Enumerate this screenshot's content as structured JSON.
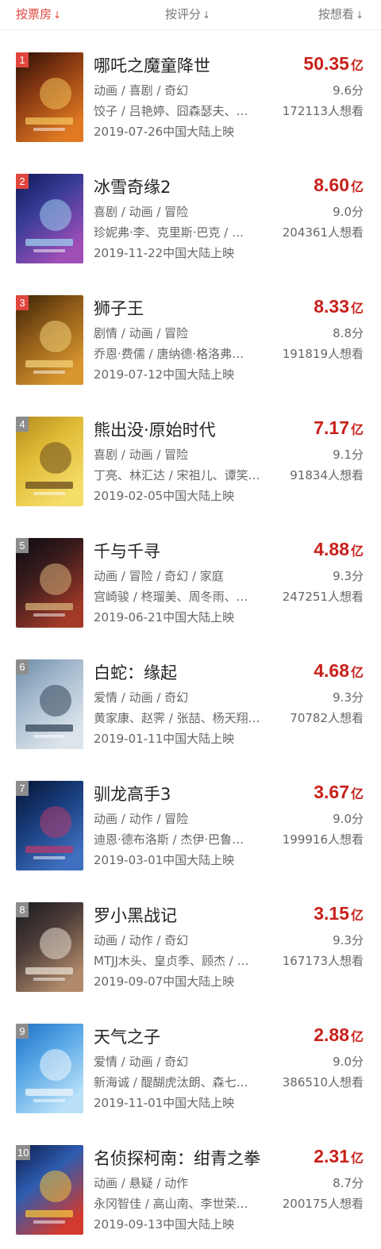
{
  "sort_tabs": [
    {
      "label": "按票房",
      "arrow": "↓"
    },
    {
      "label": "按评分",
      "arrow": "↓"
    },
    {
      "label": "按想看",
      "arrow": "↓"
    }
  ],
  "movies": [
    {
      "rank": "1",
      "title": "哪吒之魔童降世",
      "box": "50.35",
      "unit": "亿",
      "genres": "动画 / 喜剧 / 奇幻",
      "score": "9.6分",
      "cast": "饺子 / 吕艳婷、囧森瑟夫、…",
      "want": "172113人想看",
      "release": "2019-07-26中国大陆上映",
      "rank_color": "#e0463d",
      "poster_colors": [
        "#2a0f06",
        "#8a3a12",
        "#e07a22",
        "#f2c15a"
      ]
    },
    {
      "rank": "2",
      "title": "冰雪奇缘2",
      "box": "8.60",
      "unit": "亿",
      "genres": "喜剧 / 动画 / 冒险",
      "score": "9.0分",
      "cast": "珍妮弗·李、克里斯·巴克 / …",
      "want": "204361人想看",
      "release": "2019-11-22中国大陆上映",
      "rank_color": "#e0463d",
      "poster_colors": [
        "#0e1a55",
        "#3a3c98",
        "#a04fb7",
        "#9fd0f0"
      ]
    },
    {
      "rank": "3",
      "title": "狮子王",
      "box": "8.33",
      "unit": "亿",
      "genres": "剧情 / 动画 / 冒险",
      "score": "8.8分",
      "cast": "乔恩·费儒 / 唐纳德·格洛弗…",
      "want": "191819人想看",
      "release": "2019-07-12中国大陆上映",
      "rank_color": "#e0463d",
      "poster_colors": [
        "#3a2206",
        "#8d5a18",
        "#d8962e",
        "#f3d27a"
      ]
    },
    {
      "rank": "4",
      "title": "熊出没·原始时代",
      "box": "7.17",
      "unit": "亿",
      "genres": "喜剧 / 动画 / 冒险",
      "score": "9.1分",
      "cast": "丁亮、林汇达 / 宋祖儿、谭笑…",
      "want": "91834人想看",
      "release": "2019-02-05中国大陆上映",
      "rank_color": "#8c8c8c",
      "poster_colors": [
        "#b38a1e",
        "#e0bb36",
        "#f5dd6a",
        "#6a4a1c"
      ]
    },
    {
      "rank": "5",
      "title": "千与千寻",
      "box": "4.88",
      "unit": "亿",
      "genres": "动画 / 冒险 / 奇幻 / 家庭",
      "score": "9.3分",
      "cast": "宫崎骏 / 柊瑠美、周冬雨、…",
      "want": "247251人想看",
      "release": "2019-06-21中国大陆上映",
      "rank_color": "#8c8c8c",
      "poster_colors": [
        "#0d0b12",
        "#3a1c1c",
        "#a33a28",
        "#d7b07a"
      ]
    },
    {
      "rank": "6",
      "title": "白蛇：缘起",
      "box": "4.68",
      "unit": "亿",
      "genres": "爱情 / 动画 / 奇幻",
      "score": "9.3分",
      "cast": "黄家康、赵霁 / 张喆、杨天翔…",
      "want": "70782人想看",
      "release": "2019-01-11中国大陆上映",
      "rank_color": "#8c8c8c",
      "poster_colors": [
        "#6d8aa8",
        "#a7bccf",
        "#dde5ec",
        "#34465a"
      ]
    },
    {
      "rank": "7",
      "title": "驯龙高手3",
      "box": "3.67",
      "unit": "亿",
      "genres": "动画 / 动作 / 冒险",
      "score": "9.0分",
      "cast": "迪恩·德布洛斯 / 杰伊·巴鲁…",
      "want": "199916人想看",
      "release": "2019-03-01中国大陆上映",
      "rank_color": "#8c8c8c",
      "poster_colors": [
        "#071533",
        "#173a78",
        "#3f6fbf",
        "#b73a6d"
      ]
    },
    {
      "rank": "8",
      "title": "罗小黑战记",
      "box": "3.15",
      "unit": "亿",
      "genres": "动画 / 动作 / 奇幻",
      "score": "9.3分",
      "cast": "MTJJ木头、皇贞季、顾杰 / …",
      "want": "167173人想看",
      "release": "2019-09-07中国大陆上映",
      "rank_color": "#8c8c8c",
      "poster_colors": [
        "#1a1a1d",
        "#4a3b38",
        "#b08a6a",
        "#e8ddd0"
      ]
    },
    {
      "rank": "9",
      "title": "天气之子",
      "box": "2.88",
      "unit": "亿",
      "genres": "爱情 / 动画 / 奇幻",
      "score": "9.0分",
      "cast": "新海诚 / 醍醐虎汰朗、森七…",
      "want": "386510人想看",
      "release": "2019-11-01中国大陆上映",
      "rank_color": "#8c8c8c",
      "poster_colors": [
        "#1d6fc4",
        "#56a6e6",
        "#b9e0f7",
        "#eef6fb"
      ]
    },
    {
      "rank": "10",
      "title": "名侦探柯南：绀青之拳",
      "box": "2.31",
      "unit": "亿",
      "genres": "动画 / 悬疑 / 动作",
      "score": "8.7分",
      "cast": "永冈智佳 / 高山南、李世荣…",
      "want": "200175人想看",
      "release": "2019-09-13中国大陆上映",
      "rank_color": "#8c8c8c",
      "poster_colors": [
        "#0e1c4a",
        "#2d5cb0",
        "#d23a2e",
        "#f3c23a"
      ]
    }
  ]
}
